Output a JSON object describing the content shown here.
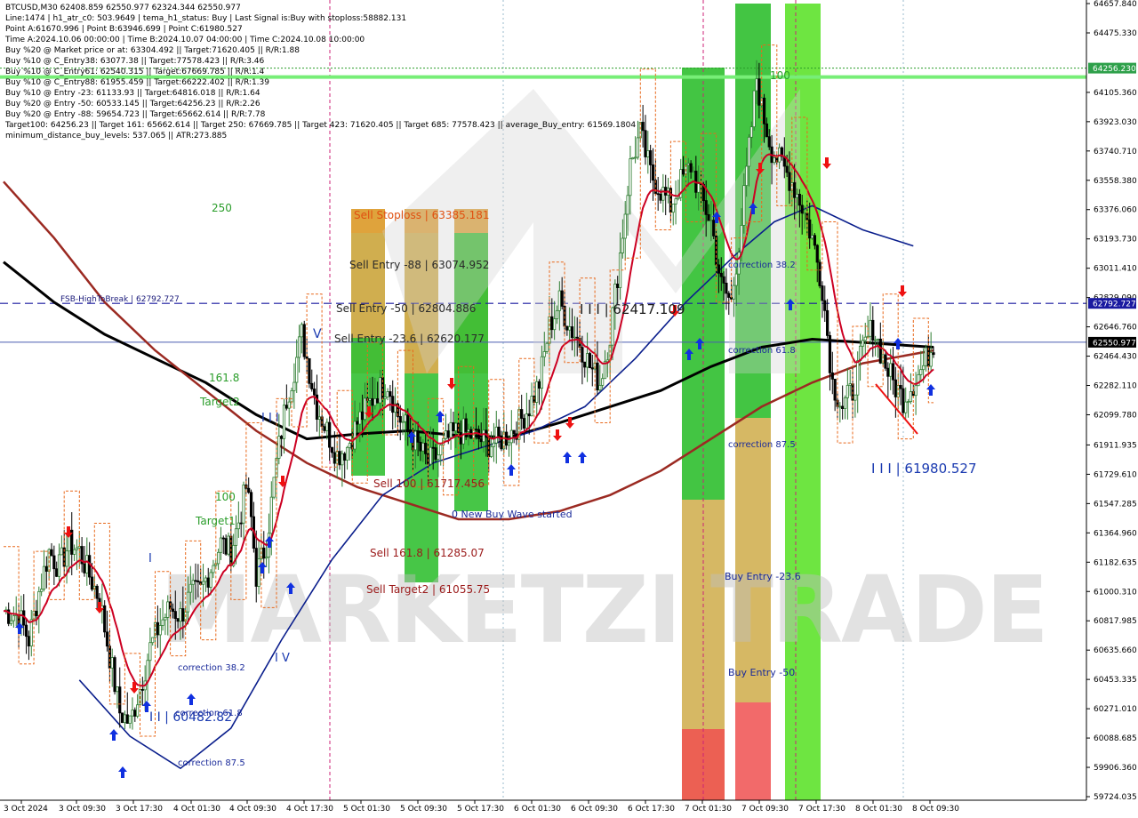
{
  "info": {
    "lines": [
      "BTCUSD,M30  62408.859 62550.977 62324.344 62550.977",
      "Line:1474  |  h1_atr_c0: 503.9649  |  tema_h1_status: Buy  |  Last Signal is:Buy with stoploss:58882.131",
      "Point A:61670.996  |  Point B:63946.699  |  Point C:61980.527",
      "Time A:2024.10.06 00:00:00  |  Time B:2024.10.07 04:00:00  |  Time C:2024.10.08 10:00:00",
      "Buy %20 @ Market price or at: 63304.492  ||  Target:71620.405  ||  R/R:1.88",
      "Buy %10 @ C_Entry38: 63077.38  ||  Target:77578.423  ||  R/R:3.46",
      "Buy %10 @ C_Entry61: 62540.315  ||  Target:67669.785  ||  R/R:1.4",
      "Buy %10 @ C_Entry88: 61955.459  ||  Target:66222.402  ||  R/R:1.39",
      "Buy %10 @ Entry -23: 61133.93  ||  Target:64816.018  ||  R/R:1.64",
      "Buy %20 @ Entry -50: 60533.145  ||  Target:64256.23  ||  R/R:2.26",
      "Buy %20 @ Entry -88: 59654.723  ||  Target:65662.614  ||  R/R:7.78",
      "Target100: 64256.23  ||  Target 161: 65662.614  ||  Target 250: 67669.785  ||  Target 423: 71620.405  ||  Target 685: 77578.423  ||  average_Buy_entry: 61569.1804",
      "minimum_distance_buy_levels: 537.065  ||  ATR:273.885"
    ]
  },
  "colors": {
    "bullish": "#2f7d32",
    "bearish": "#000000",
    "ma_black": "#000000",
    "ma_darkred": "#9b2a22",
    "ma_red": "#cc0022",
    "ma_blue": "#0a1e8c",
    "stoploss_orange": "#e8691c",
    "fsb_line": "#1a1aa0",
    "price_line": "#4a5cb0",
    "target_green": "#2a9d2a",
    "zone_green": "#33c033",
    "zone_gold": "#c8a030",
    "zone_red": "#f05050"
  },
  "price_axis": {
    "labels": [
      "64657.840",
      "64475.330",
      "64105.360",
      "63923.030",
      "63740.710",
      "63558.380",
      "63376.060",
      "63193.730",
      "63011.410",
      "62829.090",
      "62646.760",
      "62464.430",
      "62282.110",
      "62099.780",
      "61911.935",
      "61729.610",
      "61547.285",
      "61364.960",
      "61182.635",
      "61000.310",
      "60817.985",
      "60635.660",
      "60453.335",
      "60271.010",
      "60088.685",
      "59906.360",
      "59724.035"
    ],
    "tag_target": "64256.230",
    "tag_fsb": "62792.727",
    "tag_price": "62550.977"
  },
  "time_axis": {
    "labels": [
      "3 Oct 2024",
      "3 Oct 09:30",
      "3 Oct 17:30",
      "4 Oct 01:30",
      "4 Oct 09:30",
      "4 Oct 17:30",
      "5 Oct 01:30",
      "5 Oct 09:30",
      "5 Oct 17:30",
      "6 Oct 01:30",
      "6 Oct 09:30",
      "6 Oct 17:30",
      "7 Oct 01:30",
      "7 Oct 09:30",
      "7 Oct 17:30",
      "8 Oct 01:30",
      "8 Oct 09:30"
    ]
  },
  "annotations": {
    "sell_stoploss": "Sell Stoploss | 63385.181",
    "sell_entry_88": "Sell Entry -88 | 63074.952",
    "sell_entry_50": "Sell Entry -50 | 62804.886",
    "sell_entry_23": "Sell Entry -23.6 | 62620.177",
    "sell_100": "Sell 100 | 61717.456",
    "sell_161": "Sell 161.8 | 61285.07",
    "sell_target2": "Sell Target2 | 61055.75",
    "new_buy_wave": "0 New Buy Wave started",
    "fsb_label": "FSB-HighToBreak | 62792.727",
    "wave_iii_mid": "I I I | 62417.109",
    "wave_iii_right": "I I I | 61980.527",
    "wave_iii_left": "I I | 60482.82",
    "wave_v": "V",
    "wave_iii": "I I I",
    "wave_i": "I",
    "wave_iv": "I V",
    "lvl_250": "250",
    "lvl_1618": "161.8",
    "lvl_target2": "Target2",
    "lvl_100": "100",
    "lvl_target1": "Target1",
    "lvl_100_top": "100",
    "corr_382_left": "correction 38.2",
    "corr_618_left": "correction 61.8",
    "corr_875_left": "correction 87.5",
    "corr_382_right": "correction 38.2",
    "corr_618_right": "correction 61.8",
    "corr_875_right": "correction 87.5",
    "buy_entry_236": "Buy Entry -23.6",
    "buy_entry_50": "Buy Entry -50",
    "watermark": "MARKETZI TRADE"
  },
  "chart_data": {
    "type": "candlestick",
    "symbol": "BTCUSD",
    "timeframe": "M30",
    "ylim": [
      59724.035,
      64657.84
    ],
    "last": {
      "open": 62408.859,
      "high": 62550.977,
      "low": 62324.344,
      "close": 62550.977
    },
    "key_levels": {
      "target100": 64256.23,
      "fsb_high_to_break": 62792.727,
      "current_price": 62550.977
    },
    "sell_levels": [
      {
        "name": "Sell Stoploss",
        "value": 63385.181
      },
      {
        "name": "Sell Entry -88",
        "value": 63074.952
      },
      {
        "name": "Sell Entry -50",
        "value": 62804.886
      },
      {
        "name": "Sell Entry -23.6",
        "value": 62620.177
      },
      {
        "name": "Sell 100",
        "value": 61717.456
      },
      {
        "name": "Sell 161.8",
        "value": 61285.07
      },
      {
        "name": "Sell Target2",
        "value": 61055.75
      }
    ],
    "wave_points": [
      {
        "label": "I I I",
        "value": 62417.109
      },
      {
        "label": "I I I",
        "value": 61980.527
      },
      {
        "label": "I I",
        "value": 60482.82
      }
    ],
    "price_path": [
      [
        0,
        60880
      ],
      [
        6,
        60850
      ],
      [
        10,
        60700
      ],
      [
        14,
        61000
      ],
      [
        18,
        61250
      ],
      [
        22,
        61150
      ],
      [
        26,
        61300
      ],
      [
        30,
        61250
      ],
      [
        34,
        61100
      ],
      [
        38,
        60950
      ],
      [
        42,
        60600
      ],
      [
        46,
        60250
      ],
      [
        50,
        60180
      ],
      [
        54,
        60400
      ],
      [
        58,
        60650
      ],
      [
        62,
        60800
      ],
      [
        66,
        60900
      ],
      [
        70,
        60850
      ],
      [
        74,
        60980
      ],
      [
        78,
        61000
      ],
      [
        82,
        61150
      ],
      [
        86,
        61300
      ],
      [
        90,
        61250
      ],
      [
        94,
        61500
      ],
      [
        96,
        61650
      ],
      [
        98,
        61450
      ],
      [
        100,
        61100
      ],
      [
        104,
        61300
      ],
      [
        108,
        61800
      ],
      [
        112,
        62200
      ],
      [
        116,
        62450
      ],
      [
        118,
        62600
      ],
      [
        120,
        62450
      ],
      [
        124,
        62150
      ],
      [
        128,
        62000
      ],
      [
        132,
        61850
      ],
      [
        136,
        61900
      ],
      [
        140,
        62050
      ],
      [
        144,
        62150
      ],
      [
        148,
        62250
      ],
      [
        152,
        62300
      ],
      [
        156,
        62100
      ],
      [
        160,
        62000
      ],
      [
        164,
        61900
      ],
      [
        168,
        61800
      ],
      [
        172,
        61850
      ],
      [
        176,
        61950
      ],
      [
        180,
        62000
      ],
      [
        184,
        61980
      ],
      [
        188,
        61950
      ],
      [
        192,
        61920
      ],
      [
        196,
        61940
      ],
      [
        200,
        61980
      ],
      [
        204,
        62050
      ],
      [
        208,
        62150
      ],
      [
        212,
        62300
      ],
      [
        216,
        62650
      ],
      [
        220,
        62800
      ],
      [
        224,
        62650
      ],
      [
        228,
        62550
      ],
      [
        232,
        62400
      ],
      [
        236,
        62300
      ],
      [
        240,
        62600
      ],
      [
        244,
        63100
      ],
      [
        248,
        63650
      ],
      [
        252,
        63850
      ],
      [
        256,
        63600
      ],
      [
        260,
        63500
      ],
      [
        264,
        63400
      ],
      [
        268,
        63550
      ],
      [
        272,
        63650
      ],
      [
        276,
        63450
      ],
      [
        280,
        63300
      ],
      [
        284,
        62900
      ],
      [
        288,
        62800
      ],
      [
        292,
        63300
      ],
      [
        296,
        63900
      ],
      [
        298,
        64200
      ],
      [
        300,
        64000
      ],
      [
        304,
        63750
      ],
      [
        308,
        63650
      ],
      [
        312,
        63550
      ],
      [
        316,
        63400
      ],
      [
        320,
        63200
      ],
      [
        324,
        62900
      ],
      [
        328,
        62300
      ],
      [
        332,
        62150
      ],
      [
        336,
        62250
      ],
      [
        340,
        62500
      ],
      [
        344,
        62650
      ],
      [
        348,
        62450
      ],
      [
        352,
        62300
      ],
      [
        356,
        62200
      ],
      [
        360,
        62300
      ],
      [
        364,
        62400
      ],
      [
        368,
        62550
      ]
    ],
    "moving_averages": [
      {
        "color": "black",
        "points": [
          [
            0,
            63050
          ],
          [
            20,
            62800
          ],
          [
            40,
            62600
          ],
          [
            60,
            62450
          ],
          [
            80,
            62300
          ],
          [
            100,
            62100
          ],
          [
            120,
            61950
          ],
          [
            140,
            61980
          ],
          [
            160,
            62000
          ],
          [
            180,
            61970
          ],
          [
            200,
            61960
          ],
          [
            220,
            62050
          ],
          [
            240,
            62150
          ],
          [
            260,
            62250
          ],
          [
            280,
            62400
          ],
          [
            300,
            62520
          ],
          [
            320,
            62570
          ],
          [
            340,
            62550
          ],
          [
            368,
            62520
          ]
        ]
      },
      {
        "color": "darkred",
        "points": [
          [
            0,
            63550
          ],
          [
            20,
            63200
          ],
          [
            40,
            62800
          ],
          [
            60,
            62500
          ],
          [
            80,
            62250
          ],
          [
            100,
            62000
          ],
          [
            120,
            61800
          ],
          [
            140,
            61650
          ],
          [
            160,
            61550
          ],
          [
            180,
            61450
          ],
          [
            200,
            61450
          ],
          [
            220,
            61500
          ],
          [
            240,
            61600
          ],
          [
            260,
            61750
          ],
          [
            280,
            61950
          ],
          [
            300,
            62150
          ],
          [
            320,
            62300
          ],
          [
            340,
            62420
          ],
          [
            368,
            62500
          ]
        ]
      },
      {
        "color": "blue",
        "points": [
          [
            30,
            60450
          ],
          [
            50,
            60100
          ],
          [
            70,
            59900
          ],
          [
            90,
            60150
          ],
          [
            110,
            60700
          ],
          [
            130,
            61200
          ],
          [
            150,
            61600
          ],
          [
            170,
            61800
          ],
          [
            190,
            61900
          ],
          [
            210,
            62000
          ],
          [
            230,
            62150
          ],
          [
            250,
            62450
          ],
          [
            270,
            62800
          ],
          [
            290,
            63100
          ],
          [
            305,
            63300
          ],
          [
            320,
            63400
          ],
          [
            340,
            63250
          ],
          [
            360,
            63150
          ]
        ]
      }
    ]
  }
}
